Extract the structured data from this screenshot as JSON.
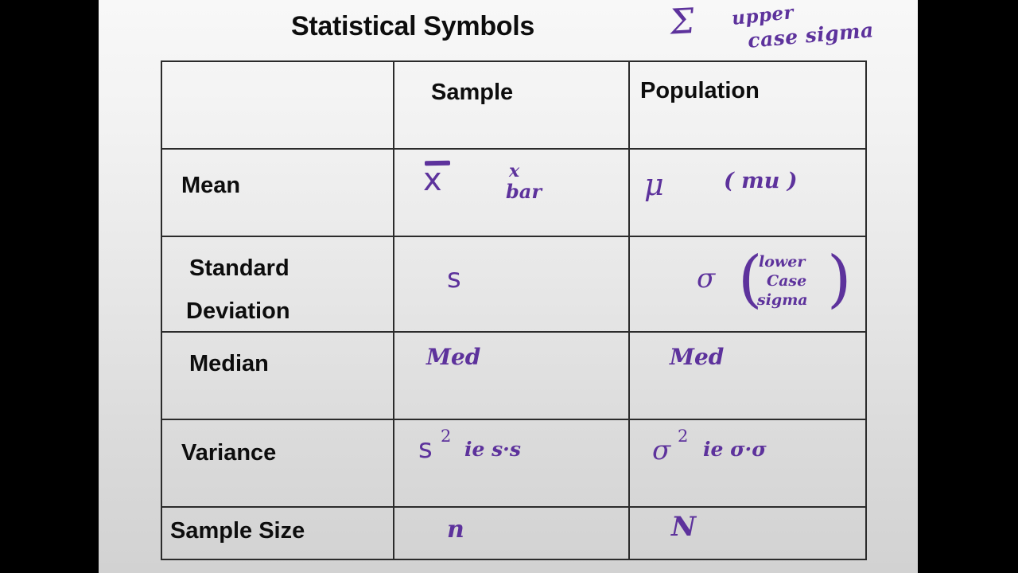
{
  "slide": {
    "title": "Statistical Symbols",
    "hand_note": {
      "symbol": "Σ",
      "line1": "upper",
      "line2": "case sigma"
    }
  },
  "table": {
    "headers": {
      "label": "",
      "sample": "Sample",
      "population": "Population"
    },
    "rows": [
      {
        "label": "Mean",
        "sample_symbol": "x̄",
        "sample_symbol_plain": "x",
        "sample_note_line1": "x",
        "sample_note_line2": "bar",
        "population_symbol": "μ",
        "population_note": "( mu )"
      },
      {
        "label_line1": "Standard",
        "label_line2": "Deviation",
        "sample_symbol": "s",
        "population_symbol": "σ",
        "population_note_line1": "lower",
        "population_note_line2": "Case",
        "population_note_line3": "sigma"
      },
      {
        "label": "Median",
        "sample_symbol": "Med",
        "population_symbol": "Med"
      },
      {
        "label": "Variance",
        "sample_symbol": "s",
        "sample_exponent": "2",
        "sample_suffix": "ie s·s",
        "population_symbol": "σ",
        "population_exponent": "2",
        "population_suffix": "ie σ·σ"
      },
      {
        "label": "Sample Size",
        "sample_symbol": "n",
        "population_symbol": "N"
      }
    ]
  },
  "colors": {
    "ink": "#5d329c",
    "text": "#0d0d0d",
    "border": "#2b2b2b",
    "letterbox": "#000000"
  }
}
